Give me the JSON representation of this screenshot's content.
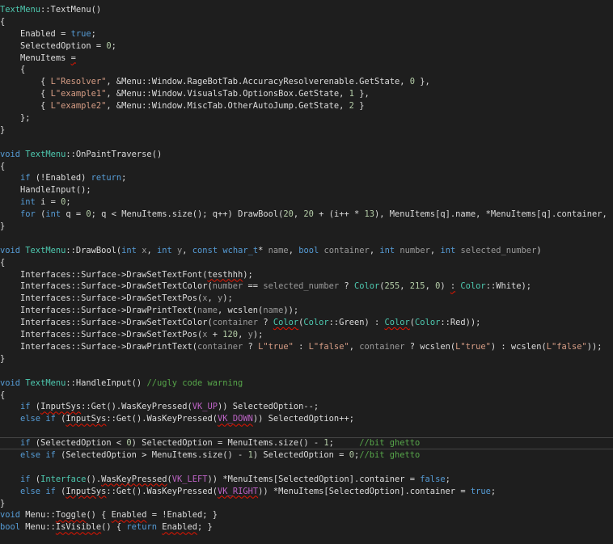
{
  "editor": {
    "current_line": 36,
    "colors": {
      "background": "#1e1e1e",
      "keyword": "#569cd6",
      "type": "#4ec9b0",
      "string": "#d69d85",
      "number": "#b5cea8",
      "comment": "#57a64a",
      "parameter": "#9a9a9a",
      "macro": "#bd63c5",
      "error_squiggle": "#e51400"
    },
    "lines": [
      [
        [
          "TextMenu",
          "ty"
        ],
        [
          "::TextMenu()",
          "pl"
        ]
      ],
      [
        [
          "{",
          "pl"
        ]
      ],
      [
        [
          "    Enabled = ",
          "pl"
        ],
        [
          "true",
          "kw"
        ],
        [
          ";",
          "pl"
        ]
      ],
      [
        [
          "    SelectedOption = ",
          "pl"
        ],
        [
          "0",
          "num"
        ],
        [
          ";",
          "pl"
        ]
      ],
      [
        [
          "    MenuItems ",
          "pl"
        ],
        [
          "=",
          "pl err"
        ]
      ],
      [
        [
          "    {",
          "pl"
        ]
      ],
      [
        [
          "        { ",
          "pl"
        ],
        [
          "L\"Resolver\"",
          "str"
        ],
        [
          ", &Menu::Window.RageBotTab.AccuracyResolverenable.GetState, ",
          "pl"
        ],
        [
          "0",
          "num"
        ],
        [
          " },",
          "pl"
        ]
      ],
      [
        [
          "        { ",
          "pl"
        ],
        [
          "L\"example1\"",
          "str"
        ],
        [
          ", &Menu::Window.VisualsTab.OptionsBox.GetState, ",
          "pl"
        ],
        [
          "1",
          "num"
        ],
        [
          " },",
          "pl"
        ]
      ],
      [
        [
          "        { ",
          "pl"
        ],
        [
          "L\"example2\"",
          "str"
        ],
        [
          ", &Menu::Window.MiscTab.OtherAutoJump.GetState, ",
          "pl"
        ],
        [
          "2",
          "num"
        ],
        [
          " }",
          "pl"
        ]
      ],
      [
        [
          "    };",
          "pl"
        ]
      ],
      [
        [
          "}",
          "pl"
        ]
      ],
      [],
      [
        [
          "void",
          "kw"
        ],
        [
          " ",
          "pl"
        ],
        [
          "TextMenu",
          "ty"
        ],
        [
          "::OnPaintTraverse()",
          "pl"
        ]
      ],
      [
        [
          "{",
          "pl"
        ]
      ],
      [
        [
          "    ",
          "pl"
        ],
        [
          "if",
          "kw"
        ],
        [
          " (!Enabled) ",
          "pl"
        ],
        [
          "return",
          "kw"
        ],
        [
          ";",
          "pl"
        ]
      ],
      [
        [
          "    HandleInput();",
          "pl"
        ]
      ],
      [
        [
          "    ",
          "pl"
        ],
        [
          "int",
          "kw"
        ],
        [
          " i = ",
          "pl"
        ],
        [
          "0",
          "num"
        ],
        [
          ";",
          "pl"
        ]
      ],
      [
        [
          "    ",
          "pl"
        ],
        [
          "for",
          "kw"
        ],
        [
          " (",
          "pl"
        ],
        [
          "int",
          "kw"
        ],
        [
          " q = ",
          "pl"
        ],
        [
          "0",
          "num"
        ],
        [
          "; q < MenuItems.size(); q++) DrawBool(",
          "pl"
        ],
        [
          "20",
          "num"
        ],
        [
          ", ",
          "pl"
        ],
        [
          "20",
          "num"
        ],
        [
          " + (i++ * ",
          "pl"
        ],
        [
          "13",
          "num"
        ],
        [
          "), MenuItems[q].name, *MenuItems[q].container,",
          "pl"
        ]
      ],
      [
        [
          "}",
          "pl"
        ]
      ],
      [],
      [
        [
          "void",
          "kw"
        ],
        [
          " ",
          "pl"
        ],
        [
          "TextMenu",
          "ty"
        ],
        [
          "::DrawBool(",
          "pl"
        ],
        [
          "int",
          "kw"
        ],
        [
          " x",
          "pa"
        ],
        [
          ", ",
          "pl"
        ],
        [
          "int",
          "kw"
        ],
        [
          " y",
          "pa"
        ],
        [
          ", ",
          "pl"
        ],
        [
          "const",
          "kw"
        ],
        [
          " ",
          "pl"
        ],
        [
          "wchar_t",
          "kw"
        ],
        [
          "* ",
          "pl"
        ],
        [
          "name",
          "pa"
        ],
        [
          ", ",
          "pl"
        ],
        [
          "bool",
          "kw"
        ],
        [
          " ",
          "pl"
        ],
        [
          "container",
          "pa"
        ],
        [
          ", ",
          "pl"
        ],
        [
          "int",
          "kw"
        ],
        [
          " ",
          "pl"
        ],
        [
          "number",
          "pa"
        ],
        [
          ", ",
          "pl"
        ],
        [
          "int",
          "kw"
        ],
        [
          " ",
          "pl"
        ],
        [
          "selected_number",
          "pa"
        ],
        [
          ")",
          "pl"
        ]
      ],
      [
        [
          "{",
          "pl"
        ]
      ],
      [
        [
          "    Interfaces::Surface->DrawSetTextFont(",
          "pl"
        ],
        [
          "testhhh",
          "pl err"
        ],
        [
          ");",
          "pl"
        ]
      ],
      [
        [
          "    Interfaces::Surface->DrawSetTextColor(",
          "pl"
        ],
        [
          "number",
          "pa"
        ],
        [
          " == ",
          "pl"
        ],
        [
          "selected_number",
          "pa"
        ],
        [
          " ? ",
          "pl"
        ],
        [
          "Color",
          "ty"
        ],
        [
          "(",
          "pl"
        ],
        [
          "255",
          "num"
        ],
        [
          ", ",
          "pl"
        ],
        [
          "215",
          "num"
        ],
        [
          ", ",
          "pl"
        ],
        [
          "0",
          "num"
        ],
        [
          ") ",
          "pl"
        ],
        [
          ":",
          "pl err"
        ],
        [
          " ",
          "pl"
        ],
        [
          "Color",
          "ty"
        ],
        [
          "::White);",
          "pl"
        ]
      ],
      [
        [
          "    Interfaces::Surface->DrawSetTextPos(",
          "pl"
        ],
        [
          "x",
          "pa"
        ],
        [
          ", ",
          "pl"
        ],
        [
          "y",
          "pa"
        ],
        [
          ");",
          "pl"
        ]
      ],
      [
        [
          "    Interfaces::Surface->DrawPrintText(",
          "pl"
        ],
        [
          "name",
          "pa"
        ],
        [
          ", wcslen(",
          "pl"
        ],
        [
          "name",
          "pa"
        ],
        [
          "));",
          "pl"
        ]
      ],
      [
        [
          "    Interfaces::Surface->DrawSetTextColor(",
          "pl"
        ],
        [
          "container",
          "pa"
        ],
        [
          " ? ",
          "pl"
        ],
        [
          "Color",
          "ty err"
        ],
        [
          "(",
          "pl"
        ],
        [
          "Color",
          "ty"
        ],
        [
          "::Green) : ",
          "pl"
        ],
        [
          "Color",
          "ty err"
        ],
        [
          "(",
          "pl"
        ],
        [
          "Color",
          "ty"
        ],
        [
          "::Red));",
          "pl"
        ]
      ],
      [
        [
          "    Interfaces::Surface->DrawSetTextPos(",
          "pl"
        ],
        [
          "x",
          "pa"
        ],
        [
          " + ",
          "pl"
        ],
        [
          "120",
          "num"
        ],
        [
          ", ",
          "pl"
        ],
        [
          "y",
          "pa"
        ],
        [
          ");",
          "pl"
        ]
      ],
      [
        [
          "    Interfaces::Surface->DrawPrintText(",
          "pl"
        ],
        [
          "container",
          "pa"
        ],
        [
          " ? ",
          "pl"
        ],
        [
          "L\"true\"",
          "str"
        ],
        [
          " : ",
          "pl"
        ],
        [
          "L\"false\"",
          "str"
        ],
        [
          ", ",
          "pl"
        ],
        [
          "container",
          "pa"
        ],
        [
          " ? wcslen(",
          "pl"
        ],
        [
          "L\"true\"",
          "str"
        ],
        [
          ") : wcslen(",
          "pl"
        ],
        [
          "L\"false\"",
          "str"
        ],
        [
          "));",
          "pl"
        ]
      ],
      [
        [
          "}",
          "pl"
        ]
      ],
      [],
      [
        [
          "void",
          "kw"
        ],
        [
          " ",
          "pl"
        ],
        [
          "TextMenu",
          "ty"
        ],
        [
          "::HandleInput() ",
          "pl"
        ],
        [
          "//ugly code warning",
          "cm"
        ]
      ],
      [
        [
          "{",
          "pl"
        ]
      ],
      [
        [
          "    ",
          "pl"
        ],
        [
          "if",
          "kw"
        ],
        [
          " (",
          "pl"
        ],
        [
          "InputSys",
          "pl err"
        ],
        [
          "::Get().WasKeyPressed(",
          "pl"
        ],
        [
          "VK_UP",
          "mac"
        ],
        [
          ")) SelectedOption--;",
          "pl"
        ]
      ],
      [
        [
          "    ",
          "pl"
        ],
        [
          "else",
          "kw"
        ],
        [
          " ",
          "pl"
        ],
        [
          "if",
          "kw"
        ],
        [
          " (",
          "pl"
        ],
        [
          "InputSys",
          "pl err"
        ],
        [
          "::Get().WasKeyPressed(",
          "pl"
        ],
        [
          "VK_DOWN",
          "mac err"
        ],
        [
          ")) SelectedOption++;",
          "pl"
        ]
      ],
      [],
      [
        [
          "    ",
          "pl"
        ],
        [
          "if",
          "kw"
        ],
        [
          " (SelectedOption < ",
          "pl"
        ],
        [
          "0",
          "num"
        ],
        [
          ") SelectedOption = MenuItems.size() - ",
          "pl"
        ],
        [
          "1",
          "num"
        ],
        [
          ";     ",
          "pl"
        ],
        [
          "//bit ghetto",
          "cm"
        ]
      ],
      [
        [
          "    ",
          "pl"
        ],
        [
          "else",
          "kw"
        ],
        [
          " ",
          "pl"
        ],
        [
          "if",
          "kw"
        ],
        [
          " (SelectedOption > MenuItems.size() - ",
          "pl"
        ],
        [
          "1",
          "num"
        ],
        [
          ") SelectedOption = ",
          "pl"
        ],
        [
          "0",
          "num"
        ],
        [
          ";",
          "pl"
        ],
        [
          "//bit ghetto",
          "cm"
        ]
      ],
      [],
      [
        [
          "    ",
          "pl"
        ],
        [
          "if",
          "kw"
        ],
        [
          " (",
          "pl"
        ],
        [
          "Interface",
          "ty"
        ],
        [
          "().",
          "pl"
        ],
        [
          "WasKeyPressed",
          "pl err"
        ],
        [
          "(",
          "pl"
        ],
        [
          "VK_LEFT",
          "mac"
        ],
        [
          ")) *MenuItems[SelectedOption].container = ",
          "pl"
        ],
        [
          "false",
          "kw"
        ],
        [
          ";",
          "pl"
        ]
      ],
      [
        [
          "    ",
          "pl"
        ],
        [
          "else",
          "kw"
        ],
        [
          " ",
          "pl"
        ],
        [
          "if",
          "kw"
        ],
        [
          " (",
          "pl"
        ],
        [
          "InputSys",
          "pl err"
        ],
        [
          "::Get().WasKeyPressed(",
          "pl"
        ],
        [
          "VK_RIGHT",
          "mac err"
        ],
        [
          ")) *MenuItems[SelectedOption].container = ",
          "pl"
        ],
        [
          "true",
          "kw"
        ],
        [
          ";",
          "pl"
        ]
      ],
      [
        [
          "}",
          "pl"
        ]
      ],
      [
        [
          "void",
          "kw"
        ],
        [
          " Menu::",
          "pl"
        ],
        [
          "Toggle",
          "pl err"
        ],
        [
          "() { ",
          "pl"
        ],
        [
          "Enabled",
          "pl err"
        ],
        [
          " = !Enabled; }",
          "pl"
        ]
      ],
      [
        [
          "bool",
          "kw"
        ],
        [
          " Menu::",
          "pl"
        ],
        [
          "IsVisible",
          "pl err"
        ],
        [
          "() { ",
          "pl"
        ],
        [
          "return",
          "kw"
        ],
        [
          " ",
          "pl"
        ],
        [
          "Enabled",
          "pl err"
        ],
        [
          "; }",
          "pl"
        ]
      ]
    ]
  }
}
